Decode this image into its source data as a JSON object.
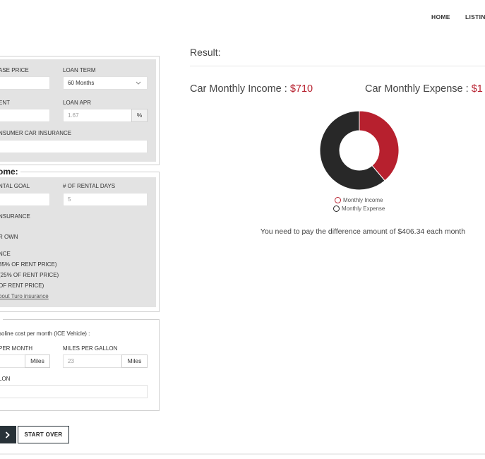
{
  "nav": {
    "home": "HOME",
    "listings": "LISTING"
  },
  "form": {
    "purchase_price_label": "ASE PRICE",
    "loan_term_label": "LOAN TERM",
    "loan_term_value": "60 Months",
    "down_payment_label": "ENT",
    "loan_apr_label": "LOAN APR",
    "loan_apr_placeholder": "1.67",
    "percent_symbol": "%",
    "insurance_label": "NSUMER CAR INSURANCE",
    "income_legend": "ome:",
    "rental_goal_label": "NTAL GOAL",
    "rental_days_label": "# OF RENTAL DAYS",
    "rental_days_placeholder": "5",
    "turo_insurance_label": "NSURANCE",
    "own_label": "R OWN",
    "nce_label": "NCE",
    "opt_35": "35% OF RENT PRICE)",
    "opt_25": "(25% OF RENT PRICE)",
    "opt_15": "OF RENT PRICE)",
    "turo_link": "bout Turo insurance",
    "expense_legend": ":",
    "gas_note": "soline cost per month (ICE Vehicle) :",
    "miles_per_month_label": "PER MONTH",
    "miles_unit": "Miles",
    "mpg_label": "MILES PER GALLON",
    "mpg_placeholder": "23",
    "mpg_unit": "Miles",
    "gallon_label": "LON"
  },
  "buttons": {
    "next_glyph": "›",
    "start_over": "START OVER"
  },
  "result": {
    "title": "Result:",
    "income_label": "Car Monthly Income : ",
    "income_value": "$710",
    "expense_label": "Car Monthly Expense : ",
    "expense_value": "$1",
    "legend_income": "Monthly Income",
    "legend_expense": "Monthly Expense",
    "summary": "You need to pay the difference amount of $406.34 each month"
  },
  "chart_data": {
    "type": "pie",
    "style": "donut",
    "categories": [
      "Monthly Income",
      "Monthly Expense"
    ],
    "values": [
      710,
      1116.34
    ],
    "colors": [
      "#b7202e",
      "#282828"
    ],
    "legend_position": "bottom"
  }
}
